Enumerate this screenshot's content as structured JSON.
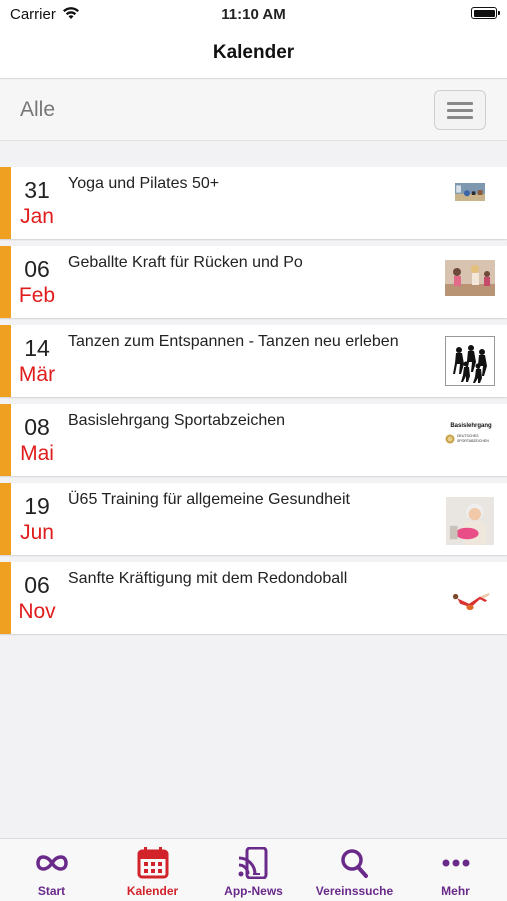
{
  "status_bar": {
    "carrier": "Carrier",
    "time": "11:10 AM"
  },
  "navbar": {
    "title": "Kalender"
  },
  "filter": {
    "selected": "Alle"
  },
  "events": [
    {
      "day": "31",
      "month": "Jan",
      "title": "Yoga und Pilates 50+",
      "thumbnail": "yoga-photo"
    },
    {
      "day": "06",
      "month": "Feb",
      "title": "Geballte Kraft für Rücken und Po",
      "thumbnail": "gym-class-photo"
    },
    {
      "day": "14",
      "month": "Mär",
      "title": "Tanzen zum Entspannen - Tanzen neu erleben",
      "thumbnail": "dancers-silhouette"
    },
    {
      "day": "08",
      "month": "Mai",
      "title": "Basislehrgang Sportabzeichen",
      "thumbnail": "sportabzeichen-logo",
      "thumb_text": "Basislehrgang",
      "thumb_subtext": "DEUTSCHES SPORTABZEICHEN"
    },
    {
      "day": "19",
      "month": "Jun",
      "title": "Ü65 Training für allgemeine Gesundheit",
      "thumbnail": "senior-woman-photo"
    },
    {
      "day": "06",
      "month": "Nov",
      "title": "Sanfte Kräftigung mit dem Redondoball",
      "thumbnail": "redondoball-exercise"
    }
  ],
  "tabs": [
    {
      "label": "Start",
      "icon": "infinity-icon"
    },
    {
      "label": "Kalender",
      "icon": "calendar-icon",
      "active": true
    },
    {
      "label": "App-News",
      "icon": "news-feed-icon"
    },
    {
      "label": "Vereinssuche",
      "icon": "search-icon"
    },
    {
      "label": "Mehr",
      "icon": "more-dots-icon"
    }
  ],
  "colors": {
    "accent_bar": "#f0a020",
    "month_red": "#e01c1c",
    "tab_purple": "#6a2a8a",
    "tab_active": "#d2232a"
  }
}
